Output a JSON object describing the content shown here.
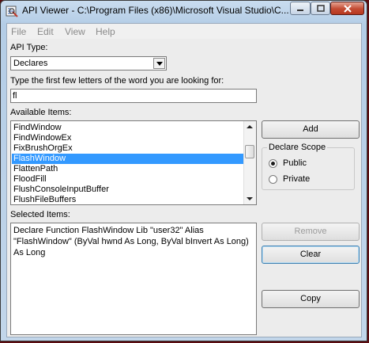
{
  "window": {
    "title": "API Viewer - C:\\Program Files (x86)\\Microsoft Visual Studio\\C..."
  },
  "menu": [
    "File",
    "Edit",
    "View",
    "Help"
  ],
  "api_type": {
    "label": "API Type:",
    "value": "Declares"
  },
  "search": {
    "label": "Type the first few letters of the word you are looking for:",
    "value": "fl"
  },
  "available": {
    "label": "Available Items:",
    "items": [
      "FindWindow",
      "FindWindowEx",
      "FixBrushOrgEx",
      "FlashWindow",
      "FlattenPath",
      "FloodFill",
      "FlushConsoleInputBuffer",
      "FlushFileBuffers"
    ],
    "selected": "FlashWindow"
  },
  "buttons": {
    "add": "Add",
    "remove": "Remove",
    "clear": "Clear",
    "copy": "Copy"
  },
  "declare_scope": {
    "title": "Declare Scope",
    "public": "Public",
    "private": "Private",
    "selected": "Public"
  },
  "selected_items": {
    "label": "Selected Items:",
    "text": "Declare Function FlashWindow Lib \"user32\" Alias \"FlashWindow\" (ByVal hwnd As Long, ByVal bInvert As Long) As Long"
  },
  "icons": {
    "app": "api-viewer-app-icon",
    "minimize": "minimize-icon",
    "maximize": "maximize-icon",
    "close": "close-icon",
    "dropdown": "chevron-down-icon"
  },
  "colors": {
    "selection": "#3399ff",
    "close_button": "#c34a32"
  }
}
